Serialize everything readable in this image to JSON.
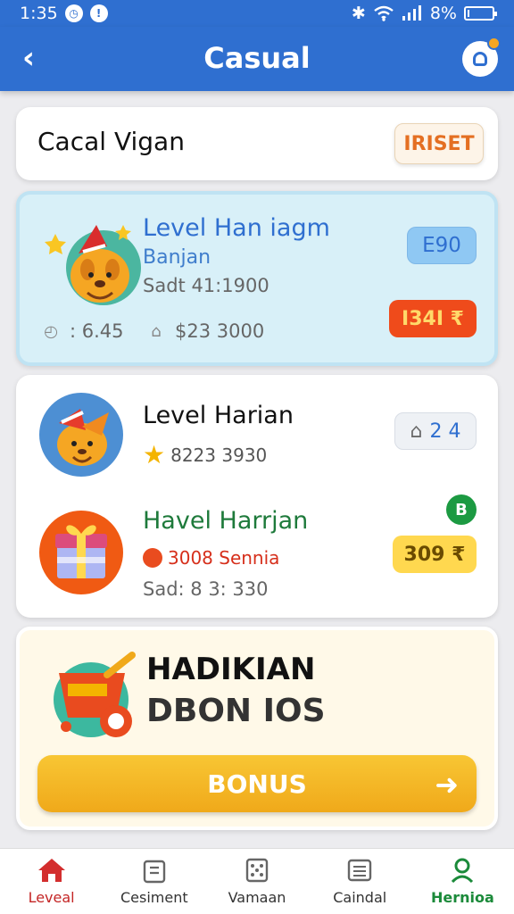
{
  "status_bar": {
    "time": "1:35",
    "battery": "8%"
  },
  "app_bar": {
    "title": "Casual"
  },
  "header": {
    "title": "Cacal Vigan",
    "reset_label": "IRISET"
  },
  "highlight_card": {
    "title": "Level Han iagm",
    "subtitle": "Banjan",
    "meta": "Sadt 41:1900",
    "stat_1": ": 6.45",
    "stat_2": "$23 3000",
    "pill_label": "E90",
    "reward_label": "I34I ₹"
  },
  "list_items": [
    {
      "title": "Level Harian",
      "subtitle": "8223 3930",
      "pill_label": "2 4"
    },
    {
      "title": "Havel Harrjan",
      "subtitle": "3008 Sennia",
      "meta": "Sad: 8 3: 330",
      "pill_label": "309 ₹",
      "badge": "B"
    }
  ],
  "bonus": {
    "title": "HADIKIAN",
    "subtitle": "DBON IOS",
    "button_label": "BONUS"
  },
  "bottom_nav": [
    {
      "label": "Leveal",
      "icon": "home-icon"
    },
    {
      "label": "Cesiment",
      "icon": "clipboard-icon"
    },
    {
      "label": "Vamaan",
      "icon": "dice-icon"
    },
    {
      "label": "Caindal",
      "icon": "calendar-list-icon"
    },
    {
      "label": "Hernioa",
      "icon": "profile-icon"
    }
  ],
  "colors": {
    "primary": "#2f6fd0",
    "accent_orange": "#e46f22",
    "reward_red": "#ef4b1b",
    "bonus_gold": "#f0a91a",
    "nav_green": "#1b8a3a",
    "nav_red": "#c42525"
  }
}
